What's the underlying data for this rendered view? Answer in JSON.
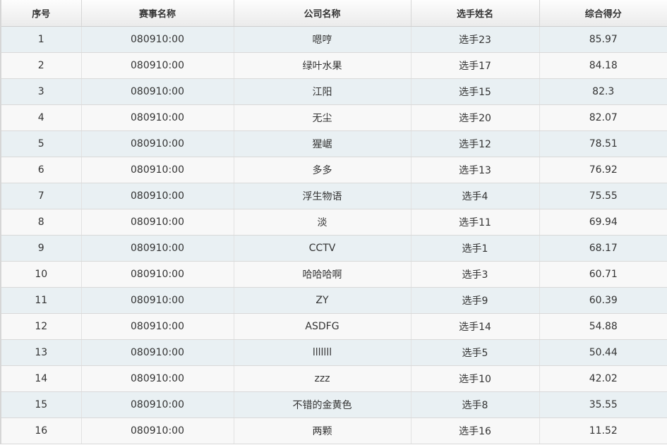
{
  "table": {
    "headers": [
      "序号",
      "赛事名称",
      "公司名称",
      "选手姓名",
      "综合得分"
    ],
    "rows": [
      {
        "rank": "1",
        "event": "080910:00",
        "company": "嗯哼",
        "player": "选手23",
        "score": "85.97"
      },
      {
        "rank": "2",
        "event": "080910:00",
        "company": "绿叶水果",
        "player": "选手17",
        "score": "84.18"
      },
      {
        "rank": "3",
        "event": "080910:00",
        "company": "江阳",
        "player": "选手15",
        "score": "82.3"
      },
      {
        "rank": "4",
        "event": "080910:00",
        "company": "无尘",
        "player": "选手20",
        "score": "82.07"
      },
      {
        "rank": "5",
        "event": "080910:00",
        "company": "猩崌",
        "player": "选手12",
        "score": "78.51"
      },
      {
        "rank": "6",
        "event": "080910:00",
        "company": "多多",
        "player": "选手13",
        "score": "76.92"
      },
      {
        "rank": "7",
        "event": "080910:00",
        "company": "浮生物语",
        "player": "选手4",
        "score": "75.55"
      },
      {
        "rank": "8",
        "event": "080910:00",
        "company": "淡",
        "player": "选手11",
        "score": "69.94"
      },
      {
        "rank": "9",
        "event": "080910:00",
        "company": "CCTV",
        "player": "选手1",
        "score": "68.17"
      },
      {
        "rank": "10",
        "event": "080910:00",
        "company": "哈哈哈啊",
        "player": "选手3",
        "score": "60.71"
      },
      {
        "rank": "11",
        "event": "080910:00",
        "company": "ZY",
        "player": "选手9",
        "score": "60.39"
      },
      {
        "rank": "12",
        "event": "080910:00",
        "company": "ASDFG",
        "player": "选手14",
        "score": "54.88"
      },
      {
        "rank": "13",
        "event": "080910:00",
        "company": "lllllll",
        "player": "选手5",
        "score": "50.44"
      },
      {
        "rank": "14",
        "event": "080910:00",
        "company": "zzz",
        "player": "选手10",
        "score": "42.02"
      },
      {
        "rank": "15",
        "event": "080910:00",
        "company": "不错的金黄色",
        "player": "选手8",
        "score": "35.55"
      },
      {
        "rank": "16",
        "event": "080910:00",
        "company": "两颗",
        "player": "选手16",
        "score": "11.52"
      }
    ]
  }
}
